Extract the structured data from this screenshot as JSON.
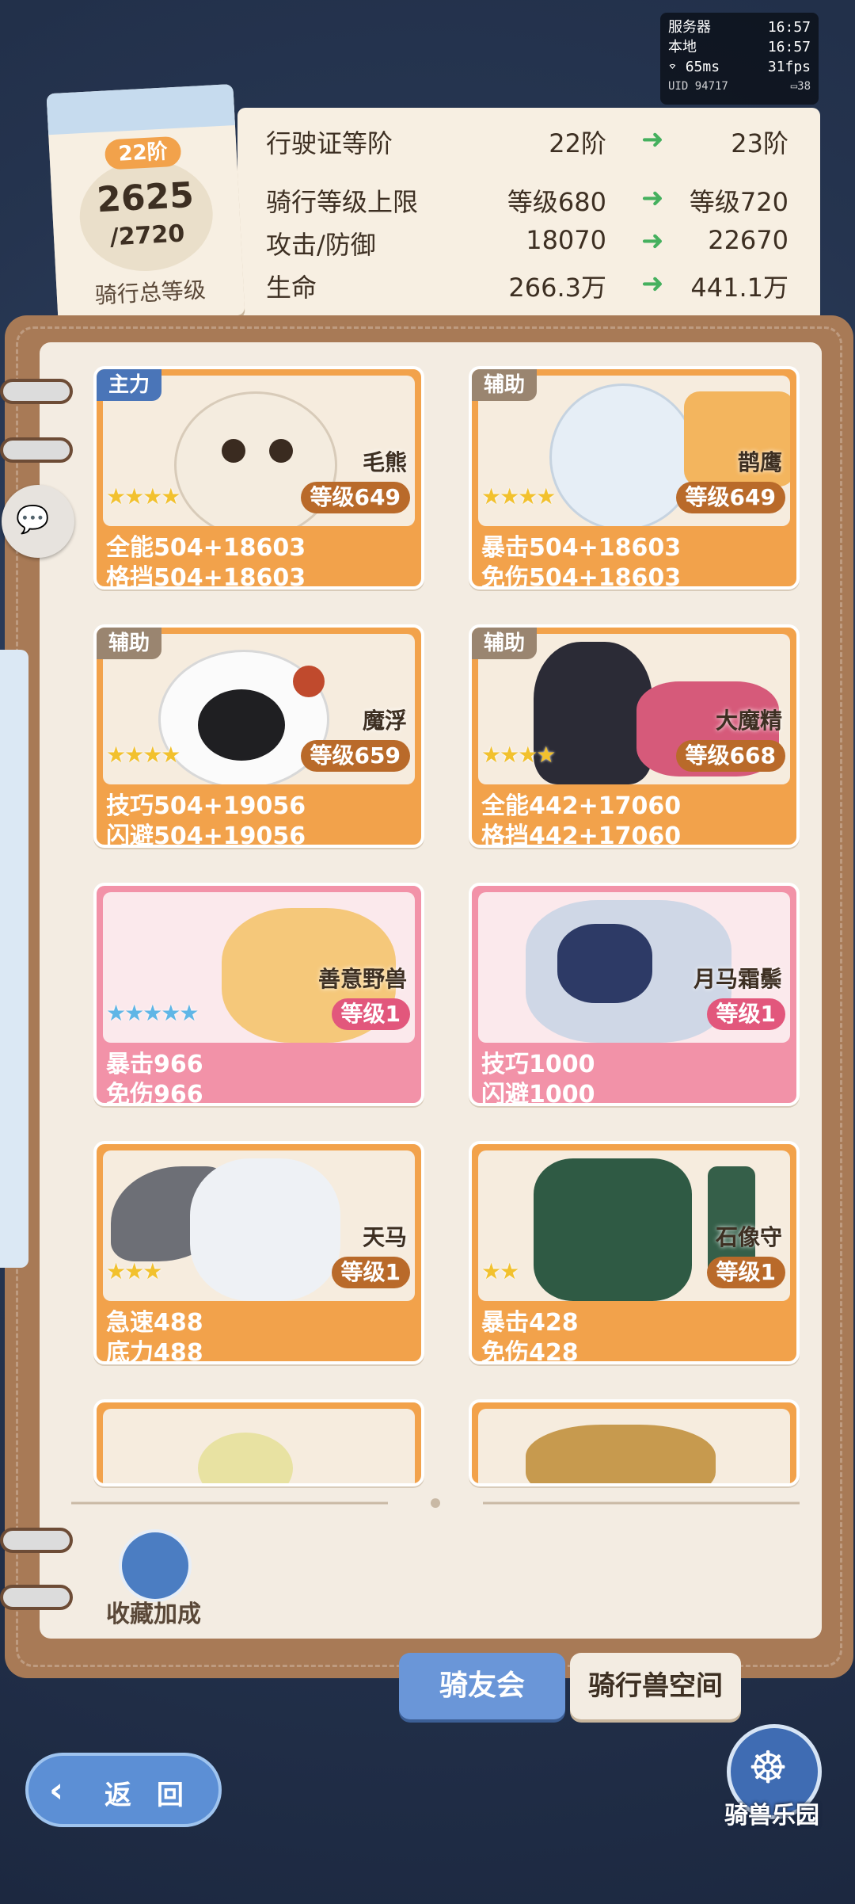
{
  "debug": {
    "server_label": "服务器",
    "server_time": "16:57",
    "local_label": "本地",
    "local_time": "16:57",
    "ping": "65ms",
    "fps": "31fps",
    "uid": "UID 94717",
    "battery": "38"
  },
  "header": {
    "tier": "22阶",
    "current_level": "2625",
    "max_level": "/2720",
    "level_label": "骑行总等级",
    "stats": [
      {
        "name": "行驶证等阶",
        "current": "22阶",
        "next": "23阶"
      },
      {
        "name": "骑行等级上限",
        "current": "等级680",
        "next": "等级720"
      },
      {
        "name": "攻击/防御",
        "current": "18070",
        "next": "22670"
      },
      {
        "name": "生命",
        "current": "266.3万",
        "next": "441.1万"
      }
    ],
    "arrow_color": "#45b05e"
  },
  "cards": [
    {
      "tag": "主力",
      "name": "毛熊",
      "stars": "★★★★",
      "level": "等级649",
      "stat1": "全能504+18603",
      "stat2": "格挡504+18603"
    },
    {
      "tag": "辅助",
      "name": "鹊鹰",
      "stars": "★★★★",
      "level": "等级649",
      "stat1": "暴击504+18603",
      "stat2": "免伤504+18603"
    },
    {
      "tag": "辅助",
      "name": "魔浮",
      "stars": "★★★★",
      "level": "等级659",
      "stat1": "技巧504+19056",
      "stat2": "闪避504+19056"
    },
    {
      "tag": "辅助",
      "name": "大魔精",
      "stars": "★★★★",
      "level": "等级668",
      "stat1": "全能442+17060",
      "stat2": "格挡442+17060"
    },
    {
      "name": "善意野兽",
      "stars": "★★★★★",
      "level": "等级1",
      "stat1": "暴击966",
      "stat2": "免伤966"
    },
    {
      "name": "月马霜鬃",
      "stars": "",
      "level": "等级1",
      "stat1": "技巧1000",
      "stat2": "闪避1000"
    },
    {
      "name": "天马",
      "stars": "★★★",
      "level": "等级1",
      "stat1": "急速488",
      "stat2": "底力488"
    },
    {
      "name": "石像守",
      "stars": "★★",
      "level": "等级1",
      "stat1": "暴击428",
      "stat2": "免伤428"
    }
  ],
  "collection_label": "收藏加成",
  "tabs": {
    "active": "骑友会",
    "inactive": "骑行兽空间"
  },
  "back_label": "返 回",
  "park_label": "骑兽乐园",
  "colors": {
    "card_orange": "#f2a24b",
    "card_pink": "#f292a8",
    "tag_main": "#4a75b8",
    "tag_assist": "#9a8570"
  }
}
